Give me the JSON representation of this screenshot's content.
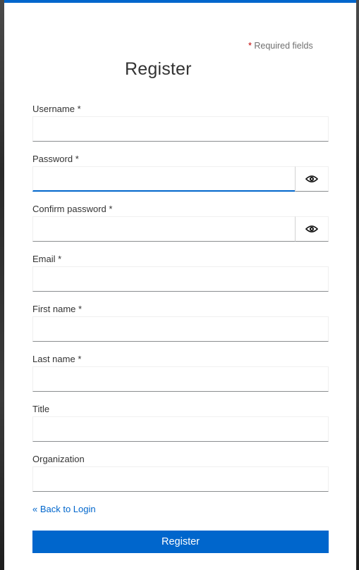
{
  "required_note": {
    "star": "*",
    "text": " Required fields"
  },
  "title": "Register",
  "fields": {
    "username": {
      "label": "Username *",
      "value": ""
    },
    "password": {
      "label": "Password *",
      "value": ""
    },
    "confirm_password": {
      "label": "Confirm password *",
      "value": ""
    },
    "email": {
      "label": "Email *",
      "value": ""
    },
    "first_name": {
      "label": "First name *",
      "value": ""
    },
    "last_name": {
      "label": "Last name *",
      "value": ""
    },
    "title": {
      "label": "Title",
      "value": ""
    },
    "organization": {
      "label": "Organization",
      "value": ""
    }
  },
  "icons": {
    "show_password": "eye-icon"
  },
  "back_link": "« Back to Login",
  "submit_label": "Register",
  "colors": {
    "accent": "#0066cc",
    "required_star": "#c00000"
  }
}
